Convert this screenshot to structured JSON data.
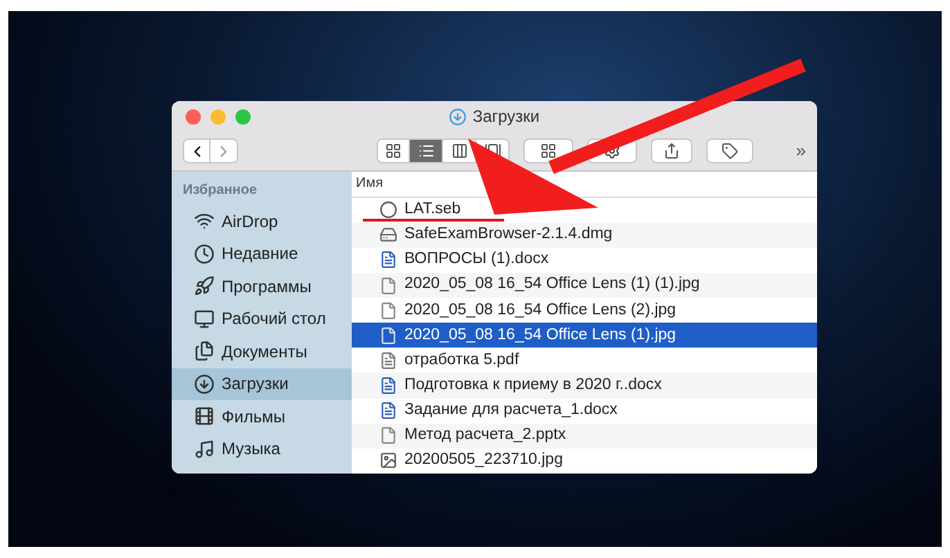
{
  "window": {
    "title": "Загрузки"
  },
  "toolbar": {
    "views": [
      {
        "kind": "icons",
        "selected": false
      },
      {
        "kind": "list",
        "selected": true
      },
      {
        "kind": "columns",
        "selected": false
      },
      {
        "kind": "gallery",
        "selected": false
      }
    ],
    "more": "»"
  },
  "sidebar": {
    "heading": "Избранное",
    "items": [
      {
        "label": "AirDrop",
        "kind": "airdrop",
        "selected": false
      },
      {
        "label": "Недавние",
        "kind": "recent",
        "selected": false
      },
      {
        "label": "Программы",
        "kind": "apps",
        "selected": false
      },
      {
        "label": "Рабочий стол",
        "kind": "desktop",
        "selected": false
      },
      {
        "label": "Документы",
        "kind": "documents",
        "selected": false
      },
      {
        "label": "Загрузки",
        "kind": "downloads",
        "selected": true
      },
      {
        "label": "Фильмы",
        "kind": "movies",
        "selected": false
      },
      {
        "label": "Музыка",
        "kind": "music",
        "selected": false
      }
    ]
  },
  "file_list": {
    "column": "Имя",
    "rows": [
      {
        "name": "LAT.seb",
        "kind": "seb",
        "selected": false
      },
      {
        "name": "SafeExamBrowser-2.1.4.dmg",
        "kind": "dmg",
        "selected": false
      },
      {
        "name": "ВОПРОСЫ (1).docx",
        "kind": "docx",
        "selected": false
      },
      {
        "name": "2020_05_08 16_54 Office Lens (1) (1).jpg",
        "kind": "image",
        "selected": false
      },
      {
        "name": "2020_05_08 16_54 Office Lens (2).jpg",
        "kind": "image",
        "selected": false
      },
      {
        "name": "2020_05_08 16_54 Office Lens (1).jpg",
        "kind": "image",
        "selected": true
      },
      {
        "name": "отработка 5.pdf",
        "kind": "pdf",
        "selected": false
      },
      {
        "name": "Подготовка к приему в 2020 г..docx",
        "kind": "docx",
        "selected": false
      },
      {
        "name": "Задание для расчета_1.docx",
        "kind": "docx",
        "selected": false
      },
      {
        "name": "Метод расчета_2.pptx",
        "kind": "pptx",
        "selected": false
      },
      {
        "name": "20200505_223710.jpg",
        "kind": "photo",
        "selected": false
      }
    ]
  }
}
